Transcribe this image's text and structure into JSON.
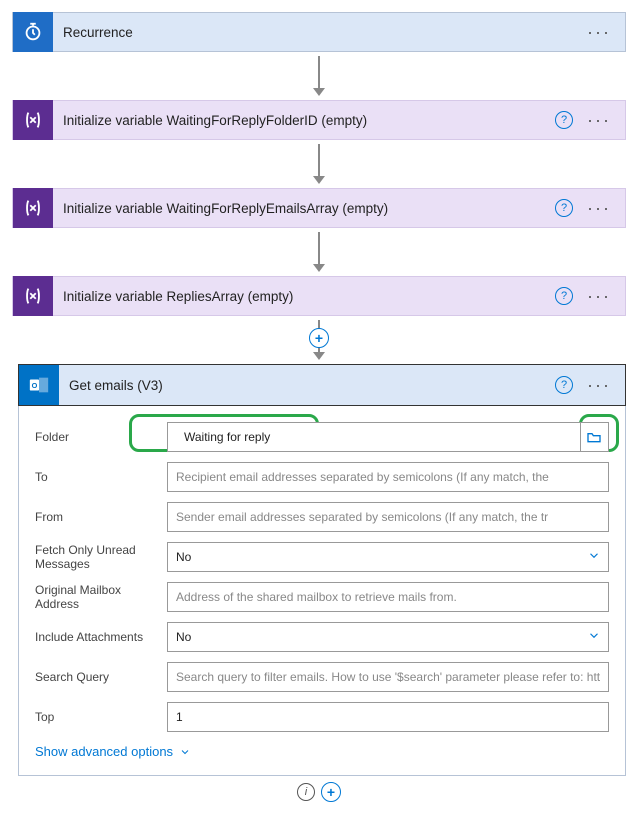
{
  "steps": [
    {
      "title": "Recurrence"
    },
    {
      "title": "Initialize variable WaitingForReplyFolderID (empty)"
    },
    {
      "title": "Initialize variable WaitingForReplyEmailsArray (empty)"
    },
    {
      "title": "Initialize variable RepliesArray (empty)"
    }
  ],
  "outlook": {
    "title": "Get emails (V3)",
    "fields": {
      "folder": {
        "label": "Folder",
        "value": "Waiting for reply"
      },
      "to": {
        "label": "To",
        "placeholder": "Recipient email addresses separated by semicolons (If any match, the"
      },
      "from": {
        "label": "From",
        "placeholder": "Sender email addresses separated by semicolons (If any match, the tr"
      },
      "fetch_unread": {
        "label": "Fetch Only Unread Messages",
        "value": "No"
      },
      "original_mailbox": {
        "label": "Original Mailbox Address",
        "placeholder": "Address of the shared mailbox to retrieve mails from."
      },
      "include_attachments": {
        "label": "Include Attachments",
        "value": "No"
      },
      "search_query": {
        "label": "Search Query",
        "placeholder": "Search query to filter emails. How to use '$search' parameter please refer to: htt"
      },
      "top": {
        "label": "Top",
        "value": "1"
      }
    },
    "advanced": "Show advanced options"
  }
}
